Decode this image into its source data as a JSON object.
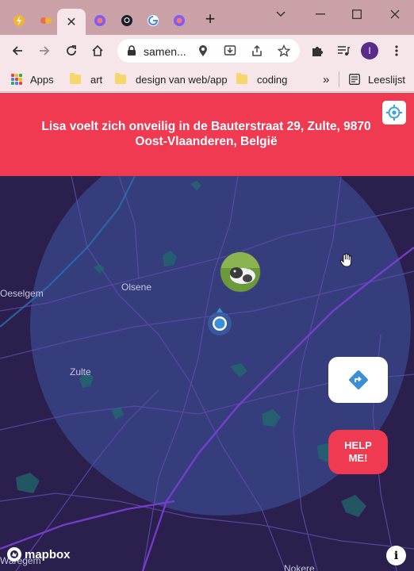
{
  "browser": {
    "tabs": [
      {
        "icon": "lightning-icon",
        "color": "#f2b233"
      },
      {
        "icon": "figma-icon",
        "color": "#e96c4c"
      },
      {
        "icon": "close-icon",
        "active": true
      },
      {
        "icon": "firefox-like-icon",
        "color": "#7b5cff"
      },
      {
        "icon": "github-icon",
        "color": "#1b1f23"
      },
      {
        "icon": "google-icon",
        "color": "#4285f4"
      },
      {
        "icon": "firefox-like-icon",
        "color": "#7b5cff"
      }
    ],
    "newtab_label": "+",
    "address": "samen...",
    "profile_initial": "I",
    "bookmarks": {
      "apps": "Apps",
      "items": [
        "art",
        "design van web/app",
        "coding"
      ],
      "more": "»",
      "reading_list": "Leeslijst"
    }
  },
  "app": {
    "alert_line1": "Lisa voelt zich onveilig in de Bauterstraat 29, Zulte, 9870",
    "alert_line2": "Oost-Vlaanderen, België",
    "colors": {
      "accent": "#ef3a52",
      "map_bg": "#2b1f4d",
      "radius": "#3a4a8f",
      "user_dot": "#3b8fd9"
    }
  },
  "map": {
    "places": {
      "olsene": "Olsene",
      "oeselgem": "Oeselgem",
      "zulte": "Zulte",
      "waregem": "Waregem",
      "nokere": "Nokere"
    },
    "route_button_icon": "directions-icon",
    "help_label_line1": "HELP",
    "help_label_line2": "ME!",
    "attribution": "mapbox",
    "info_label": "i"
  }
}
